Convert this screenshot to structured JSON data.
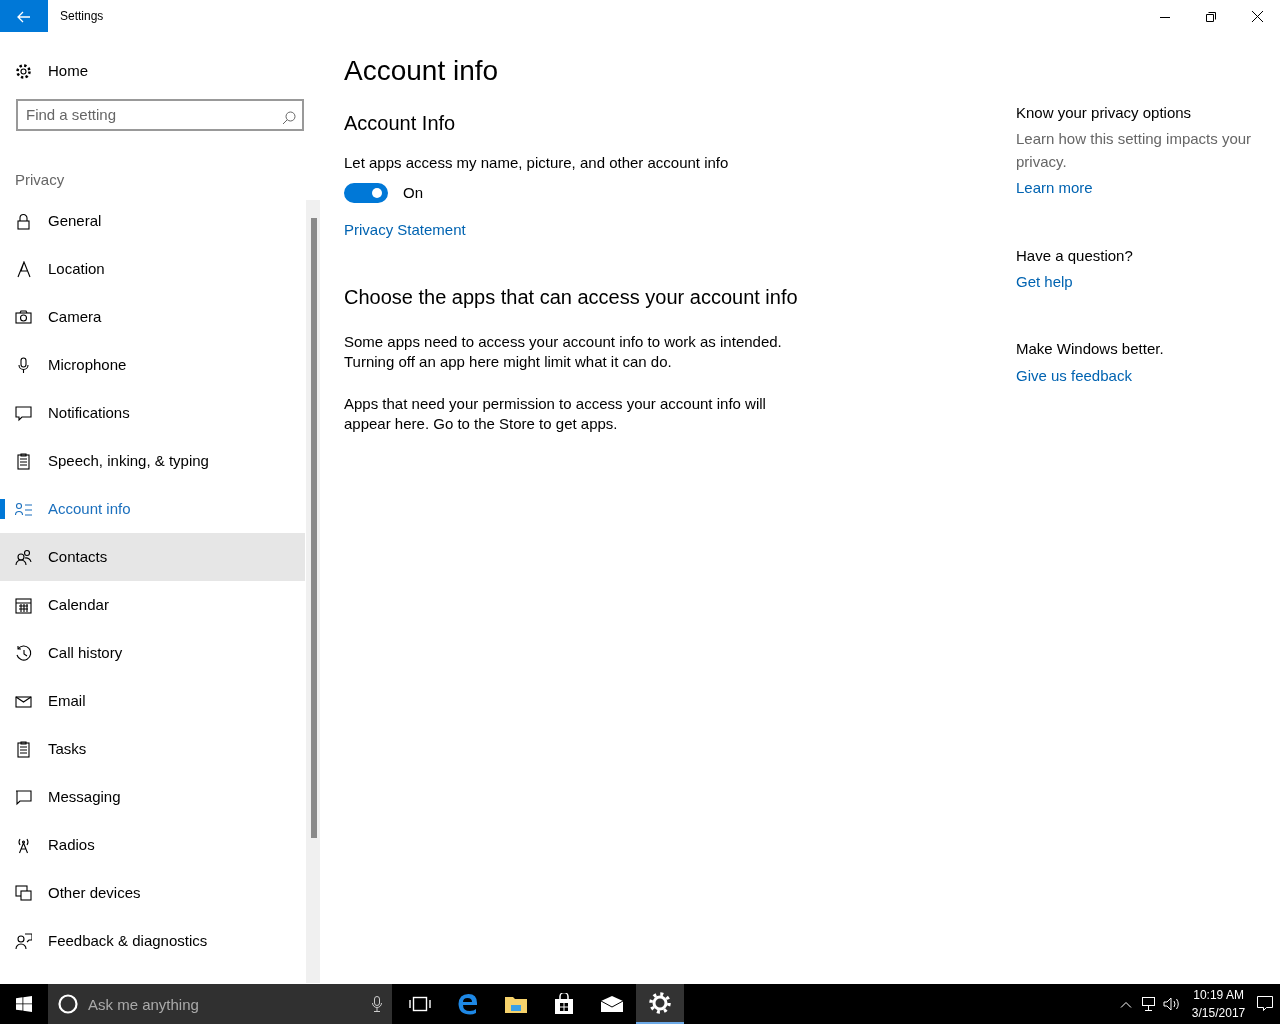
{
  "window": {
    "title": "Settings"
  },
  "sidebar": {
    "home": "Home",
    "search": {
      "placeholder": "Find a setting"
    },
    "section": "Privacy",
    "items": [
      {
        "label": "General",
        "selected": false,
        "hovered": false
      },
      {
        "label": "Location",
        "selected": false,
        "hovered": false
      },
      {
        "label": "Camera",
        "selected": false,
        "hovered": false
      },
      {
        "label": "Microphone",
        "selected": false,
        "hovered": false
      },
      {
        "label": "Notifications",
        "selected": false,
        "hovered": false
      },
      {
        "label": "Speech, inking, & typing",
        "selected": false,
        "hovered": false
      },
      {
        "label": "Account info",
        "selected": true,
        "hovered": false
      },
      {
        "label": "Contacts",
        "selected": false,
        "hovered": true
      },
      {
        "label": "Calendar",
        "selected": false,
        "hovered": false
      },
      {
        "label": "Call history",
        "selected": false,
        "hovered": false
      },
      {
        "label": "Email",
        "selected": false,
        "hovered": false
      },
      {
        "label": "Tasks",
        "selected": false,
        "hovered": false
      },
      {
        "label": "Messaging",
        "selected": false,
        "hovered": false
      },
      {
        "label": "Radios",
        "selected": false,
        "hovered": false
      },
      {
        "label": "Other devices",
        "selected": false,
        "hovered": false
      },
      {
        "label": "Feedback & diagnostics",
        "selected": false,
        "hovered": false
      }
    ]
  },
  "main": {
    "title": "Account info",
    "subtitle": "Account Info",
    "toggle_label": "Let apps access my name, picture, and other account info",
    "toggle": {
      "on": true,
      "reading": "On"
    },
    "link": "Privacy Statement",
    "section_title": "Choose the apps that can access your account info",
    "paragraphs": [
      "Some apps need to access your account info to work as intended. Turning off an app here might limit what it can do.",
      "Apps that need your permission to access your account info will appear here. Go to the Store to get apps."
    ]
  },
  "aside": [
    {
      "heading": "Know your privacy options",
      "text": "Learn how this setting impacts your privacy.",
      "link": "Learn more"
    },
    {
      "heading": "Have a question?",
      "link": "Get help"
    },
    {
      "heading": "Make Windows better.",
      "link": "Give us feedback"
    }
  ],
  "taskbar": {
    "search": {
      "placeholder": "Ask me anything"
    },
    "apps": [
      {
        "kind": "taskview",
        "active": false
      },
      {
        "kind": "edge",
        "active": false
      },
      {
        "kind": "explorer",
        "active": false
      },
      {
        "kind": "store",
        "active": false
      },
      {
        "kind": "mail",
        "active": false
      },
      {
        "kind": "settings",
        "active": true
      }
    ],
    "time": "10:19 AM",
    "date": "3/15/2017"
  }
}
